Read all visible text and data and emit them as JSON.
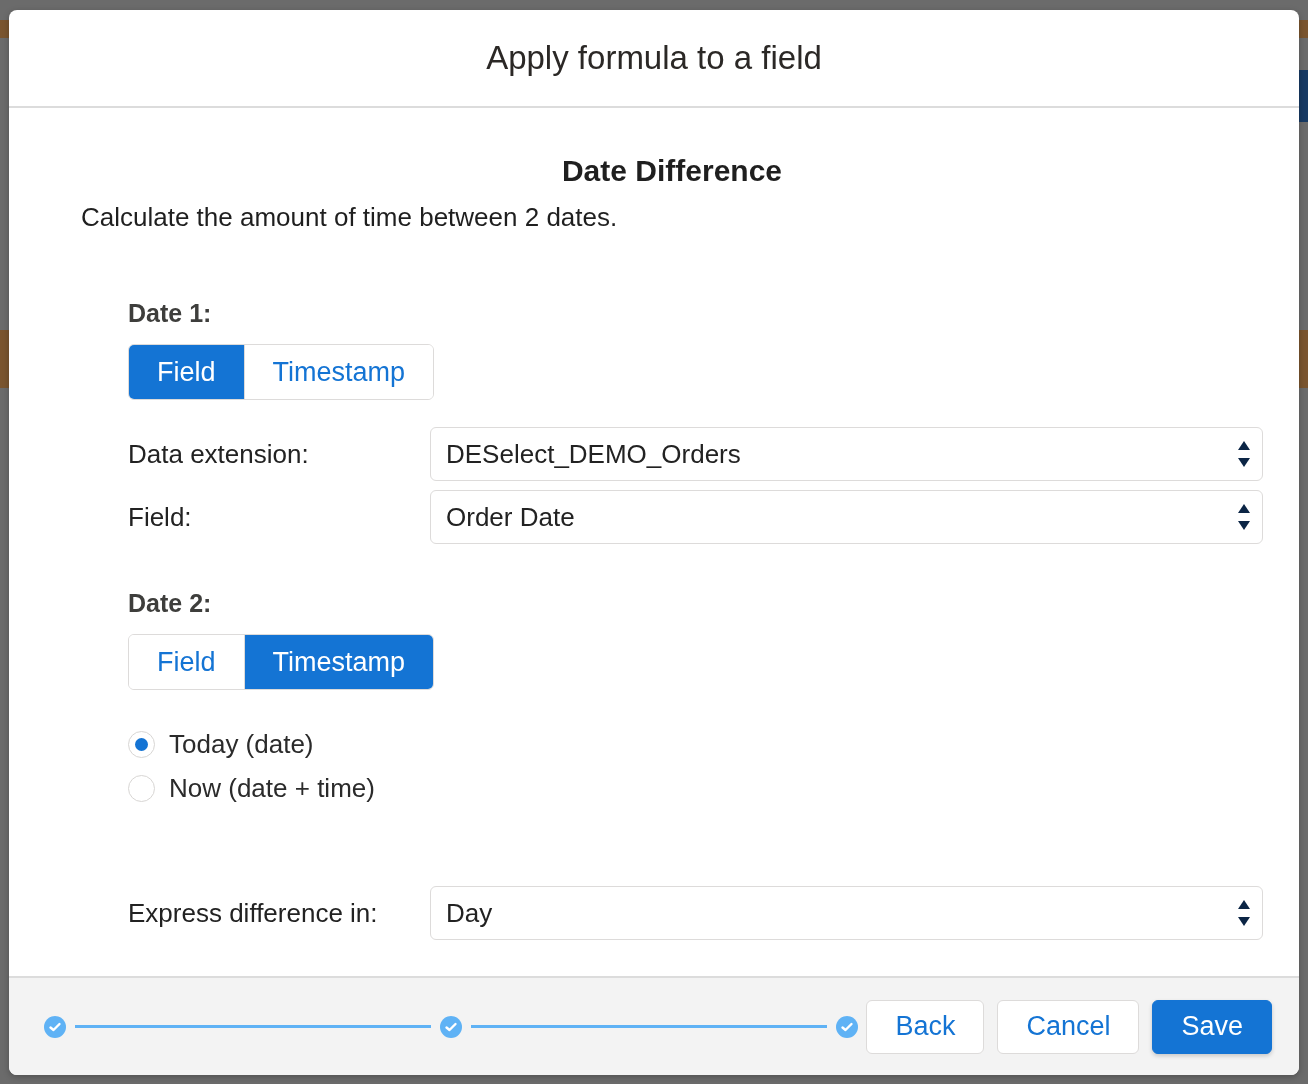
{
  "dialog": {
    "title": "Apply formula to a field"
  },
  "heading": "Date Difference",
  "description": "Calculate the amount of time between 2 dates.",
  "dates": [
    {
      "label": "Date 1:",
      "toggle": [
        {
          "label": "Field",
          "selected": true
        },
        {
          "label": "Timestamp",
          "selected": false
        }
      ],
      "fields": [
        {
          "label": "Data extension:",
          "value": "DESelect_DEMO_Orders"
        },
        {
          "label": "Field:",
          "value": "Order Date"
        }
      ]
    },
    {
      "label": "Date 2:",
      "toggle": [
        {
          "label": "Field",
          "selected": false
        },
        {
          "label": "Timestamp",
          "selected": true
        }
      ],
      "options": [
        {
          "label": "Today (date)",
          "selected": true
        },
        {
          "label": "Now (date + time)",
          "selected": false
        }
      ]
    }
  ],
  "express": {
    "label": "Express difference in:",
    "value": "Day"
  },
  "steps": [
    {
      "completed": true
    },
    {
      "completed": true
    },
    {
      "completed": true
    }
  ],
  "buttons": [
    {
      "label": "Back",
      "primary": false
    },
    {
      "label": "Cancel",
      "primary": false
    },
    {
      "label": "Save",
      "primary": true
    }
  ]
}
